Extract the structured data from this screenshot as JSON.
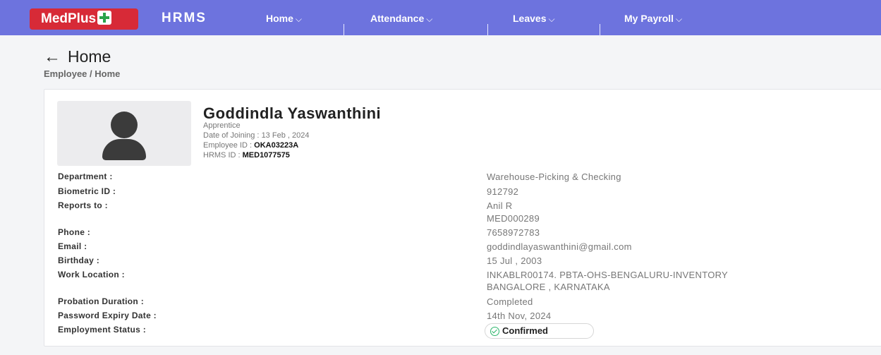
{
  "header": {
    "logo_text": "MedPlus",
    "app_name": "HRMS",
    "nav": [
      {
        "label": "Home"
      },
      {
        "label": "Attendance"
      },
      {
        "label": "Leaves"
      },
      {
        "label": "My Payroll"
      }
    ],
    "colors": {
      "bar": "#6d73de",
      "logo": "#d72a37",
      "logo_cross": "#2aa34a"
    }
  },
  "page": {
    "title": "Home",
    "back_icon": "arrow-left-icon",
    "breadcrumb": "Employee / Home"
  },
  "profile": {
    "avatar_icon": "user-silhouette-icon",
    "name": "Goddindla Yaswanthini",
    "designation": "Apprentice",
    "doj_label": "Date of Joining :",
    "doj_value": "13 Feb , 2024",
    "emp_id_label": "Employee ID :",
    "emp_id_value": "OKA03223A",
    "hrms_id_label": "HRMS ID :",
    "hrms_id_value": "MED1077575"
  },
  "details": [
    {
      "label": "Department :",
      "value": "Warehouse-Picking & Checking"
    },
    {
      "label": "Biometric ID :",
      "value": "912792"
    },
    {
      "label": "Reports to :",
      "value": "Anil R",
      "value2": "MED000289"
    },
    {
      "label": "Phone :",
      "value": "7658972783"
    },
    {
      "label": "Email :",
      "value": "goddindlayaswanthini@gmail.com"
    },
    {
      "label": "Birthday :",
      "value": "15 Jul , 2003"
    },
    {
      "label": "Work Location :",
      "value": "INKABLR00174. PBTA-OHS-BENGALURU-INVENTORY",
      "value2": "BANGALORE , KARNATAKA"
    },
    {
      "label": "Probation Duration :",
      "value": "Completed"
    },
    {
      "label": "Password Expiry Date :",
      "value": "14th Nov, 2024"
    },
    {
      "label": "Employment Status :",
      "value": "Confirmed",
      "status_icon": "check-circle-icon",
      "status_color": "#2bb56a"
    }
  ]
}
